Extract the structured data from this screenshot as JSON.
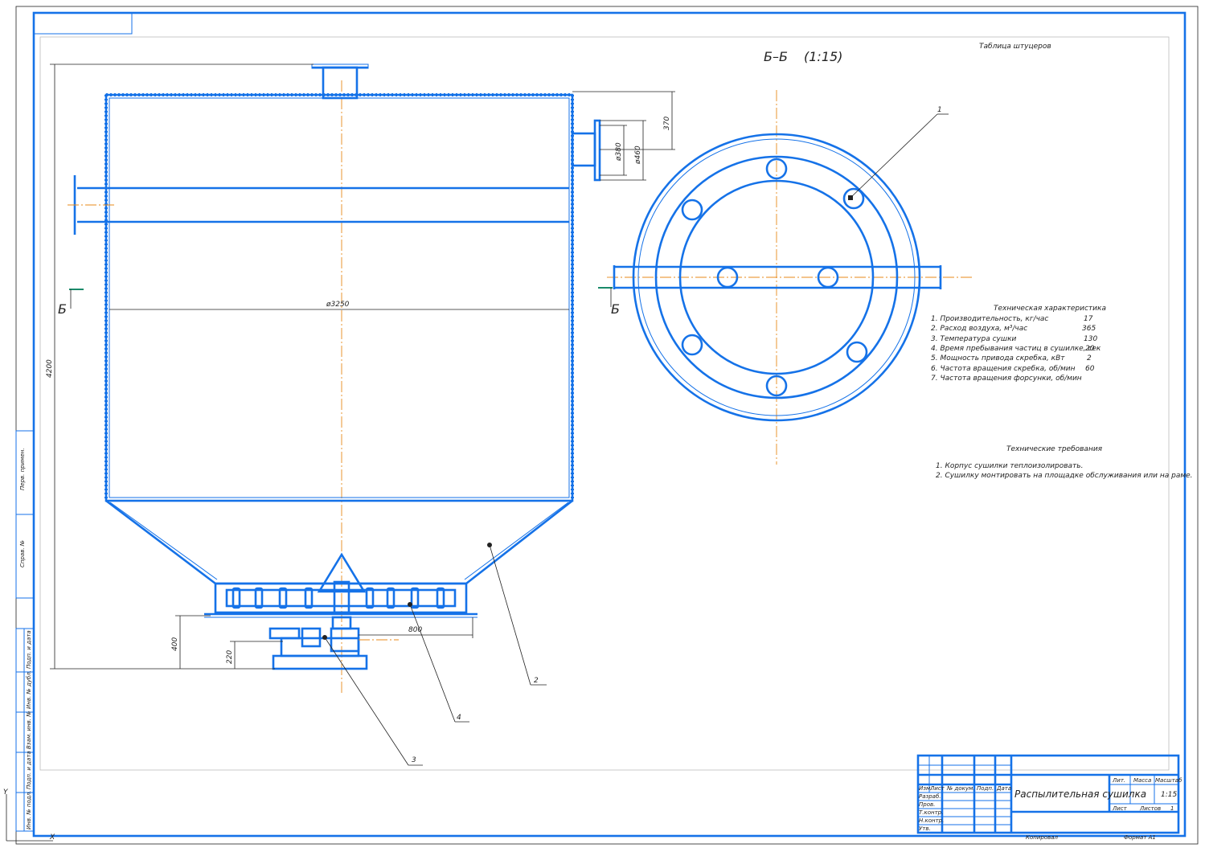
{
  "section": {
    "title": "Б–Б",
    "scale": "(1:15)"
  },
  "nozzle_table_title": "Таблица штуцеров",
  "section_marks": {
    "left": "Б",
    "right": "Б"
  },
  "dimensions": {
    "height_total": "4200",
    "diameter_body": "ø3250",
    "nozzle_offset": "370",
    "nozzle_d1": "ø380",
    "nozzle_d2": "ø460",
    "base_height": "400",
    "drive_height": "220",
    "drive_width": "800"
  },
  "callouts": [
    "1",
    "2",
    "3",
    "4"
  ],
  "tech_characteristics": {
    "title": "Техническая характеристика",
    "rows": [
      {
        "label": "1. Производительность, кг/час",
        "value": "17"
      },
      {
        "label": "2. Расход воздуха, м³/час",
        "value": "365"
      },
      {
        "label": "3. Температура сушки",
        "value": "130"
      },
      {
        "label": "4. Время пребывания частиц в сушилке, сек",
        "value": "20"
      },
      {
        "label": "5. Мощность привода скребка, кВт",
        "value": "2"
      },
      {
        "label": "6. Частота вращения скребка, об/мин",
        "value": "60"
      },
      {
        "label": "7. Частота вращения форсунки, об/мин",
        "value": ""
      }
    ]
  },
  "tech_requirements": {
    "title": "Технические требования",
    "items": [
      "1. Корпус сушилки теплоизолировать.",
      "2. Сушилку монтировать на площадке обслуживания или на раме."
    ]
  },
  "title_block": {
    "name": "Распылительная сушилка",
    "col_headers": [
      "Изм.",
      "Лист",
      "№ докум.",
      "Подп.",
      "Дата"
    ],
    "row_labels": [
      "Разраб.",
      "Пров.",
      "Т.контр.",
      "Н.контр.",
      "Утв."
    ],
    "lit_label": "Лит.",
    "mass_label": "Масса",
    "scale_label": "Масштаб",
    "scale_value": "1:15",
    "sheet_label": "Лист",
    "sheets_label": "Листов",
    "sheets_value": "1",
    "copied": "Копировал",
    "format": "Формат  A1"
  },
  "side_stamp": [
    "Перв. примен.",
    "Справ. №",
    "Подп. и дата",
    "Инв. № дубл.",
    "Взам. инв. №",
    "Подп. и дата",
    "Инв. № подл."
  ],
  "axis_labels": {
    "y": "Y",
    "x": "X"
  },
  "colors": {
    "lines": "#1572e8",
    "axis": "#e88a1a",
    "text": "#222222"
  }
}
